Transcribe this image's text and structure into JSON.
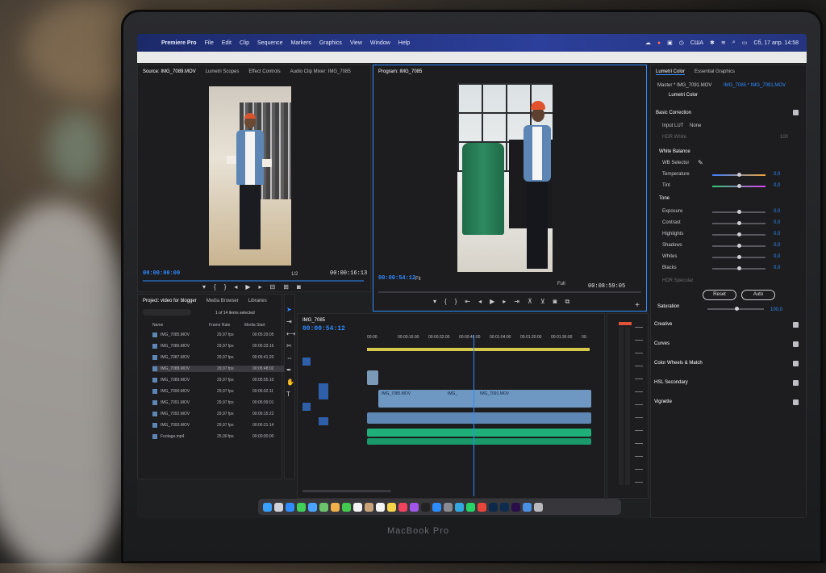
{
  "menubar": {
    "app": "Premiere Pro",
    "items": [
      "File",
      "Edit",
      "Clip",
      "Sequence",
      "Markers",
      "Graphics",
      "View",
      "Window",
      "Help"
    ],
    "keyboard": "США",
    "datetime": "Сб, 17 апр.  14:58"
  },
  "source": {
    "tabs": [
      "Source: IMG_7089.MOV",
      "Lumetri Scopes",
      "Effect Controls",
      "Audio Clip Mixer: IMG_7085"
    ],
    "timecode": "00:00:00:00",
    "duration": "00:00:16:13",
    "fit": "1/2"
  },
  "program": {
    "tab": "Program: IMG_7085",
    "timecode": "00:00:54:12",
    "fit": "Fit",
    "quality": "Full",
    "duration": "00:08:59:05"
  },
  "lumetri": {
    "tabs": [
      "Lumetri Color",
      "Essential Graphics"
    ],
    "master": "Master * IMG_7091.MOV",
    "clip": "IMG_7085 * IMG_7091.MOV",
    "effect": "Lumetri Color",
    "basic_correction": "Basic Correction",
    "input_lut_label": "Input LUT",
    "input_lut_value": "None",
    "hdr_white": "HDR White",
    "hdr_white_value": "100",
    "white_balance": "White Balance",
    "wb_selector": "WB Selector",
    "temperature": "Temperature",
    "tint": "Tint",
    "tone": "Tone",
    "exposure": "Exposure",
    "contrast": "Contrast",
    "highlights": "Highlights",
    "shadows": "Shadows",
    "whites": "Whites",
    "blacks": "Blacks",
    "hdr_specular": "HDR Specular",
    "zero": "0,0",
    "reset": "Reset",
    "auto": "Auto",
    "saturation": "Saturation",
    "saturation_value": "100,0",
    "creative": "Creative",
    "curves": "Curves",
    "color_wheels": "Color Wheels & Match",
    "hsl": "HSL Secondary",
    "vignette": "Vignette"
  },
  "project": {
    "tabs": [
      "Project: video for blogger",
      "Media Browser",
      "Libraries"
    ],
    "selected_info": "1 of 14 items selected",
    "columns": [
      "Name",
      "Frame Rate",
      "Media Start"
    ],
    "rows": [
      {
        "name": "IMG_7085.MOV",
        "fps": "29,97 fps",
        "start": "00:05:29:05"
      },
      {
        "name": "IMG_7086.MOV",
        "fps": "29,97 fps",
        "start": "00:05:33:16"
      },
      {
        "name": "IMG_7087.MOV",
        "fps": "29,97 fps",
        "start": "00:05:41:20"
      },
      {
        "name": "IMG_7088.MOV",
        "fps": "29,97 fps",
        "start": "00:05:48:02"
      },
      {
        "name": "IMG_7089.MOV",
        "fps": "29,97 fps",
        "start": "00:05:55:10"
      },
      {
        "name": "IMG_7090.MOV",
        "fps": "29,97 fps",
        "start": "00:06:02:11"
      },
      {
        "name": "IMG_7091.MOV",
        "fps": "29,97 fps",
        "start": "00:06:09:01"
      },
      {
        "name": "IMG_7092.MOV",
        "fps": "29,97 fps",
        "start": "00:06:15:22"
      },
      {
        "name": "IMG_7093.MOV",
        "fps": "29,97 fps",
        "start": "00:06:21:14"
      },
      {
        "name": "Footage.mp4",
        "fps": "25,00 fps",
        "start": "00:00:00:00"
      }
    ]
  },
  "timeline": {
    "tab": "IMG_7085",
    "timecode": "00:00:54:12",
    "ruler": [
      "00:00",
      "00:00:16:00",
      "00:00:32:00",
      "00:00:48:00",
      "00:01:04:00",
      "00:01:20:00",
      "00:01:36:00",
      "00:"
    ],
    "clip_labels": [
      "IMG_7085.MOV",
      "IMG_",
      "IMG_7091.MOV"
    ]
  },
  "macbook_label": "MacBook Pro",
  "colors": {
    "accent": "#2f8bff",
    "menubar": "#2c3f9a",
    "audio_track": "#1fb07a",
    "video_track": "#3b6fa8"
  }
}
